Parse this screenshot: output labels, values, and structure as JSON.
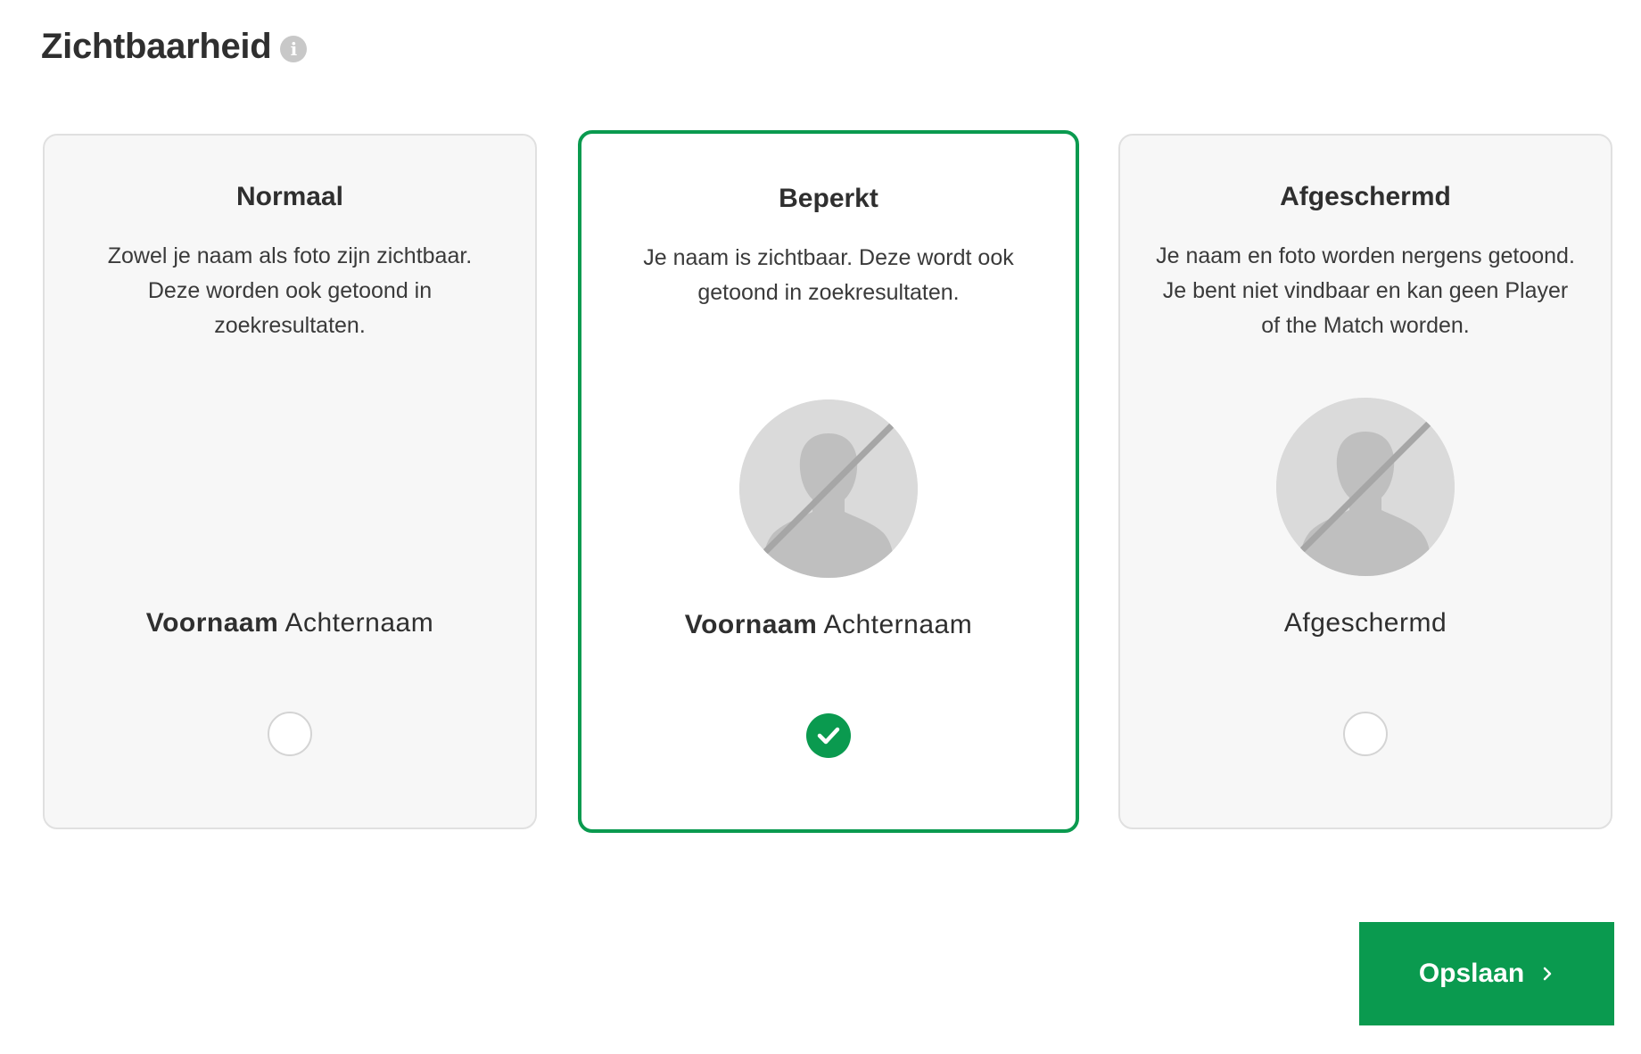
{
  "header": {
    "title": "Zichtbaarheid",
    "info_icon": "info-icon"
  },
  "options": [
    {
      "title": "Normaal",
      "description": "Zowel je naam als foto zijn zichtbaar. Deze worden ook getoond in zoekresultaten.",
      "name_first": "Voornaam",
      "name_last": "Achternaam",
      "avatar": "none",
      "selected": false
    },
    {
      "title": "Beperkt",
      "description": "Je naam is zichtbaar. Deze wordt ook getoond in zoekresultaten.",
      "name_first": "Voornaam",
      "name_last": "Achternaam",
      "avatar": "hidden-photo-icon",
      "selected": true
    },
    {
      "title": "Afgeschermd",
      "description": "Je naam en foto worden nergens getoond. Je bent niet vindbaar en kan geen Player of the Match worden.",
      "name_plain": "Afgeschermd",
      "avatar": "hidden-photo-icon",
      "selected": false
    }
  ],
  "save_button": {
    "label": "Opslaan",
    "icon": "chevron-right-icon"
  },
  "colors": {
    "accent": "#0a9a4f",
    "card_bg": "#f7f7f7",
    "card_border": "#e0e0e0",
    "text": "#2f2f2f"
  }
}
